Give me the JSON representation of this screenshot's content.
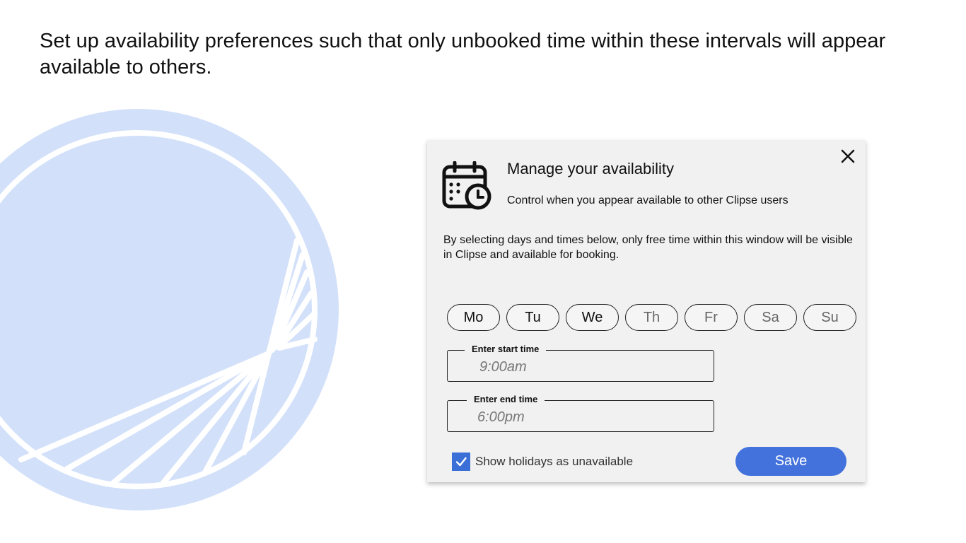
{
  "slide": {
    "headline": "Set up availability preferences such that only unbooked time within these intervals will appear available to others.",
    "logo_icon": "clipse-logo",
    "logo_color": "#d2e0fa"
  },
  "dialog": {
    "title": "Manage your availability",
    "subtitle": "Control when you appear available to other Clipse users",
    "description": "By selecting days and times below, only free time within this window will be visible in Clipse and available for booking.",
    "close_icon": "close-icon",
    "header_icon": "calendar-clock-icon",
    "days": [
      {
        "label": "Mo",
        "selected": true
      },
      {
        "label": "Tu",
        "selected": true
      },
      {
        "label": "We",
        "selected": true
      },
      {
        "label": "Th",
        "selected": false
      },
      {
        "label": "Fr",
        "selected": false
      },
      {
        "label": "Sa",
        "selected": false
      },
      {
        "label": "Su",
        "selected": false
      }
    ],
    "start_time": {
      "label": "Enter start time",
      "placeholder": "9:00am"
    },
    "end_time": {
      "label": "Enter end time",
      "placeholder": "6:00pm"
    },
    "holidays": {
      "label": "Show holidays as unavailable",
      "checked": true
    },
    "save_label": "Save",
    "accent_color": "#4472dc"
  }
}
